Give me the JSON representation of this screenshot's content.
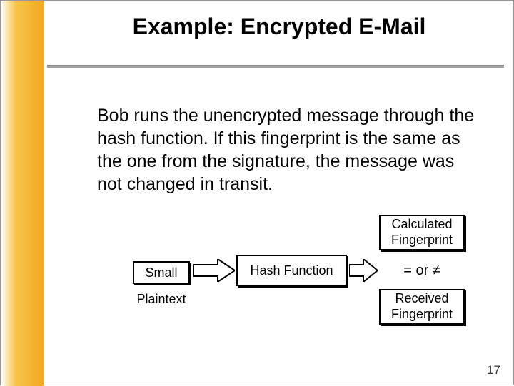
{
  "slide": {
    "title": "Example: Encrypted E-Mail",
    "body": "Bob runs the unencrypted message through the hash function. If this fingerprint is the same as the one from the signature, the message was not changed in transit.",
    "page_number": "17"
  },
  "diagram": {
    "calc_line1": "Calculated",
    "calc_line2": "Fingerprint",
    "small_label": "Small",
    "plaintext_label": "Plaintext",
    "hash_label": "Hash Function",
    "equals_label": "= or ≠",
    "recv_line1": "Received",
    "recv_line2": "Fingerprint"
  }
}
